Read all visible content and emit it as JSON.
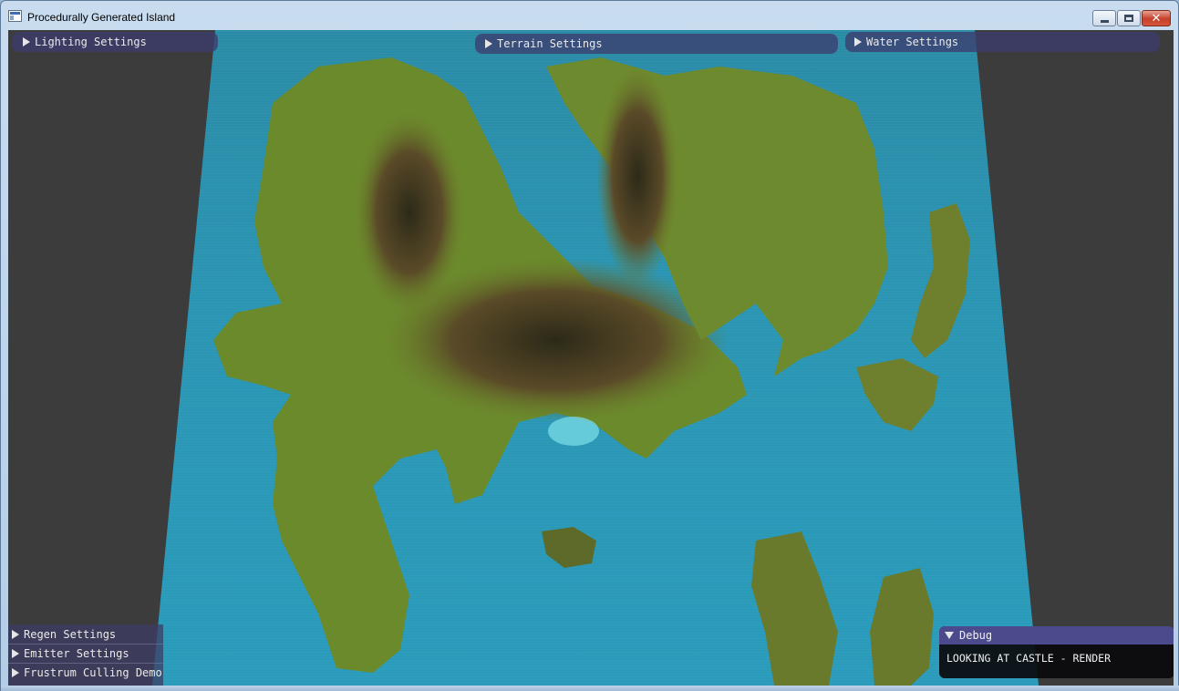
{
  "window": {
    "title": "Procedurally Generated Island",
    "icon": "app-window-icon",
    "minimize_icon": "minimize-icon",
    "maximize_icon": "maximize-icon",
    "close_icon": "close-icon",
    "close_glyph": "✕"
  },
  "top_panels": {
    "lighting": "Lighting Settings",
    "terrain": "Terrain Settings",
    "water": "Water Settings"
  },
  "bottom_panels": {
    "regen": "Regen Settings",
    "emitter": "Emitter Settings",
    "frustum": "Frustrum Culling Demo"
  },
  "debug": {
    "title": "Debug",
    "text": "LOOKING AT CASTLE - RENDER"
  },
  "colors": {
    "imgui_header": "#4a4a8c",
    "water": "#2a95b3",
    "grass": "#6e8a2a",
    "mountain": "#5a4a2a",
    "background": "#3c3c3c"
  }
}
